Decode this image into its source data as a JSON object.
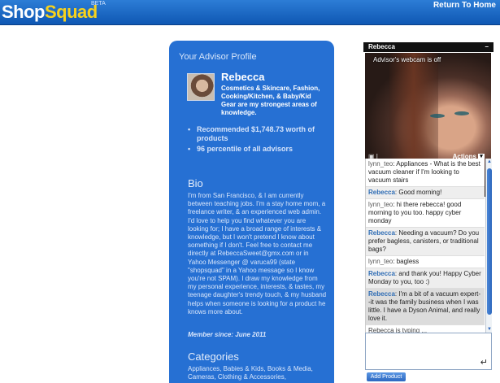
{
  "header": {
    "logo_shop": "Shop",
    "logo_squad": "Squad",
    "logo_beta": "BETA",
    "home_link": "Return To Home"
  },
  "profile": {
    "title": "Your Advisor Profile",
    "name": "Rebecca",
    "expertise": "Cosmetics & Skincare, Fashion, Cooking/Kitchen, & Baby/Kid Gear are my strongest areas of knowledge.",
    "stats": [
      "Recommended $1,748.73 worth of products",
      "96 percentile of all advisors"
    ],
    "bio_title": "Bio",
    "bio": "I'm from San Francisco, & I am currently between teaching jobs. I'm a stay home mom, a freelance writer, & an experienced web admin. I'd love to help you find whatever you are looking for; I have a broad range of interests & knowledge, but I won't pretend I know about something if I don't. Feel free to contact me directly at RebeccaSweet@gmx.com or in Yahoo Messenger @ varuca99 (state \"shopsquad\" in a Yahoo message so I know you're not SPAM). I draw my knowledge from my personal experience, interests, & tastes, my teenage daughter's trendy touch, & my husband helps when someone is looking for a product he knows more about.",
    "member_since": "Member since: June 2011",
    "categories_title": "Categories",
    "categories": "Appliances, Babies & Kids, Books & Media, Cameras, Clothing & Accessories,"
  },
  "chat": {
    "title": "Rebecca",
    "minimize": "–",
    "webcam_note": "Advisor's webcam is off",
    "actions_label": "Actions",
    "messages": [
      {
        "who": "lynn_teo",
        "text": ": Appliances - What is the best vacuum cleaner if I'm looking to vacuum stairs",
        "role": "user"
      },
      {
        "who": "Rebecca",
        "text": ": Good morning!",
        "role": "advisor"
      },
      {
        "who": "lynn_teo",
        "text": ": hi there rebecca! good morning to you too. happy cyber monday",
        "role": "user"
      },
      {
        "who": "Rebecca",
        "text": ": Needing a vacuum? Do you prefer bagless, canisters, or traditional bags?",
        "role": "advisor"
      },
      {
        "who": "lynn_teo",
        "text": ": bagless",
        "role": "user"
      },
      {
        "who": "Rebecca",
        "text": ": and thank you! Happy Cyber Monday to you, too :)",
        "role": "advisor"
      },
      {
        "who": "Rebecca",
        "text": ": I'm a bit of a vacuum expert--it was the family business when I was little. I have a Dyson Animal, and really love it.",
        "role": "advisor-hl"
      }
    ],
    "typing": "Rebecca is typing ...",
    "add_product": "Add Product"
  },
  "colors": {
    "header_blue": "#1660c0",
    "card_blue": "#2670d3",
    "logo_yellow": "#f7d21d",
    "name_link": "#2f6db5"
  }
}
